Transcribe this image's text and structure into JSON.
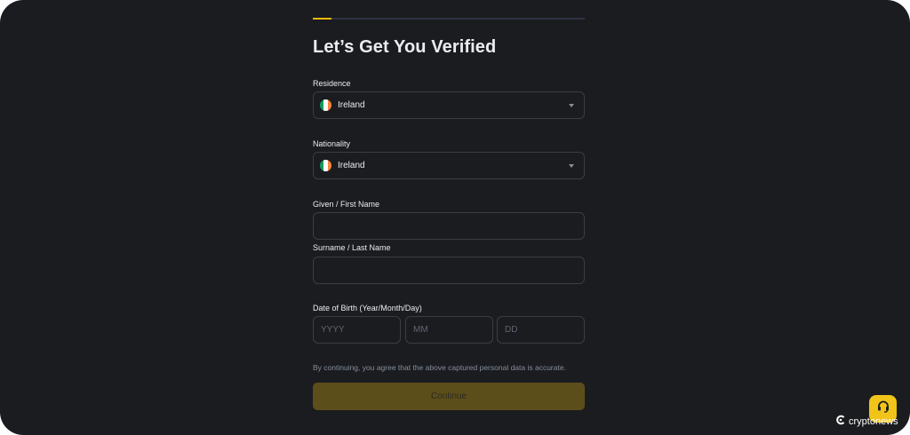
{
  "progress": {
    "value": 0.07,
    "color": "#f0b90b"
  },
  "page_title": "Let’s Get You Verified",
  "residence": {
    "label": "Residence",
    "value": "Ireland",
    "flag_icon": "ireland-flag-icon"
  },
  "nationality": {
    "label": "Nationality",
    "value": "Ireland",
    "flag_icon": "ireland-flag-icon"
  },
  "first_name": {
    "label": "Given / First Name",
    "value": "",
    "placeholder": ""
  },
  "last_name": {
    "label": "Surname / Last Name",
    "value": "",
    "placeholder": ""
  },
  "dob": {
    "label": "Date of Birth (Year/Month/Day)",
    "year_placeholder": "YYYY",
    "month_placeholder": "MM",
    "day_placeholder": "DD"
  },
  "disclaimer": "By continuing, you agree that the above captured personal data is accurate.",
  "continue_label": "Continue",
  "support_icon": "headset-icon",
  "watermark": {
    "brand": "cryptonews",
    "logo_icon": "cryptonews-logo-icon"
  },
  "colors": {
    "background": "#1b1c1f",
    "accent": "#f0b90b",
    "button_disabled": "#5c4e1a",
    "border": "#3a3d44"
  }
}
